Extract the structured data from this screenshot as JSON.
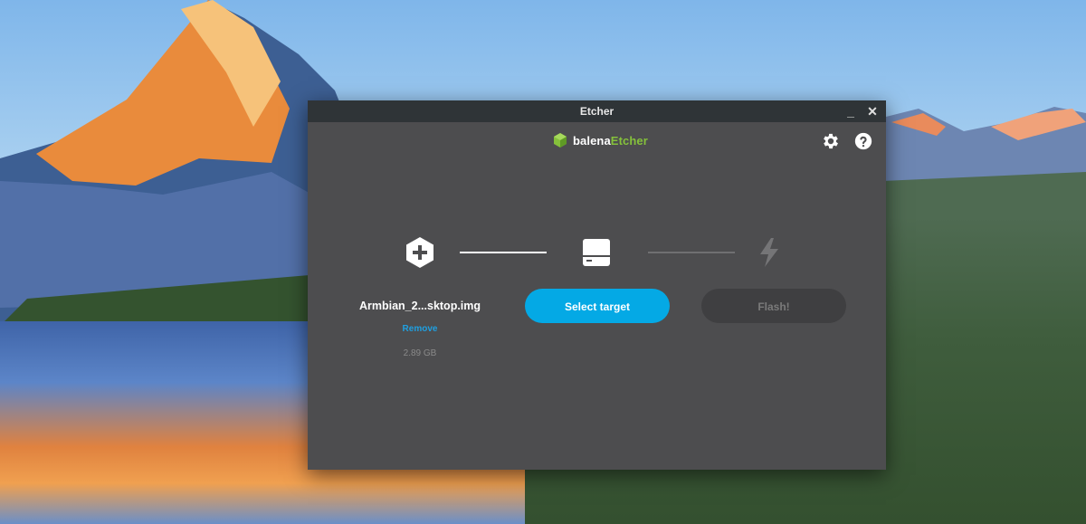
{
  "window": {
    "title": "Etcher"
  },
  "controls": {
    "minimize": "_",
    "close": "✕"
  },
  "header": {
    "brand_prefix": "balena",
    "brand_suffix": "Etcher",
    "settings_icon": "gear-icon",
    "help_icon": "help-icon"
  },
  "steps": {
    "image": {
      "icon": "plus-hexagon-icon",
      "filename": "Armbian_2...sktop.img",
      "remove_label": "Remove",
      "size": "2.89 GB"
    },
    "target": {
      "icon": "drive-icon",
      "button_label": "Select target"
    },
    "flash": {
      "icon": "lightning-icon",
      "button_label": "Flash!"
    }
  },
  "colors": {
    "window_bg": "#4d4d4f",
    "titlebar_bg": "#2f3437",
    "accent_blue": "#04a9e5",
    "brand_green": "#85c13b",
    "disabled_button": "#3f3f41"
  }
}
